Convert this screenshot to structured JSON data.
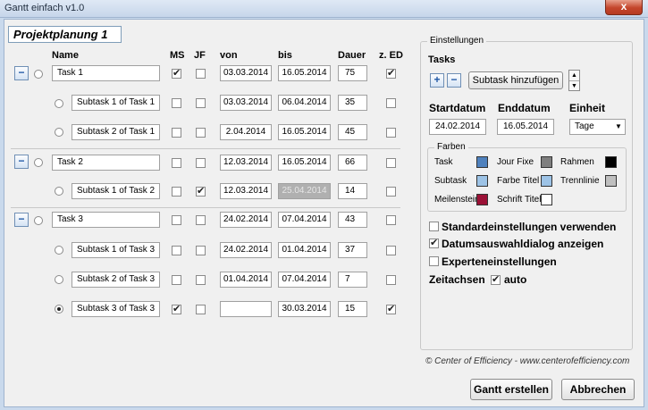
{
  "window": {
    "title": "Gantt einfach v1.0",
    "close": "x"
  },
  "project": {
    "title": "Projektplanung 1"
  },
  "columns": {
    "name": "Name",
    "ms": "MS",
    "jf": "JF",
    "von": "von",
    "bis": "bis",
    "dauer": "Dauer",
    "zed": "z. ED"
  },
  "collapse_symbol": "−",
  "rows": [
    {
      "name": "Task 1",
      "von": "03.03.2014",
      "bis": "16.05.2014",
      "dauer": "75",
      "ms": true,
      "jf": false,
      "zed": true,
      "radio": false
    },
    {
      "name": "Subtask 1 of Task 1",
      "von": "03.03.2014",
      "bis": "06.04.2014",
      "dauer": "35",
      "ms": false,
      "jf": false,
      "zed": false,
      "radio": false
    },
    {
      "name": "Subtask 2 of Task 1",
      "von": "2.04.2014",
      "bis": "16.05.2014",
      "dauer": "45",
      "ms": false,
      "jf": false,
      "zed": false,
      "radio": false
    },
    {
      "name": "Task 2",
      "von": "12.03.2014",
      "bis": "16.05.2014",
      "dauer": "66",
      "ms": false,
      "jf": false,
      "zed": false,
      "radio": false
    },
    {
      "name": "Subtask 1 of Task 2",
      "von": "12.03.2014",
      "bis": "25.04.2014",
      "dauer": "14",
      "ms": false,
      "jf": true,
      "zed": false,
      "radio": false
    },
    {
      "name": "Task 3",
      "von": "24.02.2014",
      "bis": "07.04.2014",
      "dauer": "43",
      "ms": false,
      "jf": false,
      "zed": false,
      "radio": false
    },
    {
      "name": "Subtask 1 of Task 3",
      "von": "24.02.2014",
      "bis": "01.04.2014",
      "dauer": "37",
      "ms": false,
      "jf": false,
      "zed": false,
      "radio": false
    },
    {
      "name": "Subtask 2 of Task 3",
      "von": "01.04.2014",
      "bis": "07.04.2014",
      "dauer": "7",
      "ms": false,
      "jf": false,
      "zed": false,
      "radio": false
    },
    {
      "name": "Subtask 3 of Task 3",
      "von": "",
      "bis": "30.03.2014",
      "dauer": "15",
      "ms": true,
      "jf": false,
      "zed": true,
      "radio": true
    }
  ],
  "settings": {
    "group_title": "Einstellungen",
    "tasks_label": "Tasks",
    "add_label": "+",
    "remove_label": "−",
    "add_subtask_label": "Subtask hinzufügen",
    "startdatum_label": "Startdatum",
    "enddatum_label": "Enddatum",
    "einheit_label": "Einheit",
    "startdatum_value": "24.02.2014",
    "enddatum_value": "16.05.2014",
    "einheit_value": "Tage",
    "farben": {
      "title": "Farben",
      "task": "Task",
      "task_color": "#4f81bd",
      "jour_fixe": "Jour Fixe",
      "jour_fixe_color": "#7f7f7f",
      "rahmen": "Rahmen",
      "rahmen_color": "#000000",
      "subtask": "Subtask",
      "subtask_color": "#9dc3e6",
      "farbe_titel": "Farbe Titel",
      "farbe_titel_color": "#9dc3e6",
      "trennlinie": "Trennlinie",
      "trennlinie_color": "#bfbfbf",
      "meilenstein": "Meilenstein",
      "meilenstein_color": "#9b1136",
      "schrift_titel": "Schrift Titel",
      "schrift_titel_color": "#ffffff"
    },
    "standard": {
      "label": "Standardeinstellungen verwenden",
      "checked": false
    },
    "datumsauswahl": {
      "label": "Datumsauswahldialog anzeigen",
      "checked": true
    },
    "experte": {
      "label": "Experteneinstellungen",
      "checked": false
    },
    "zeitachsen_label": "Zeitachsen",
    "auto": {
      "label": "auto",
      "checked": true
    }
  },
  "footer": {
    "copyright": "© Center of Efficiency - www.centerofefficiency.com"
  },
  "buttons": {
    "create": "Gantt erstellen",
    "cancel": "Abbrechen"
  }
}
